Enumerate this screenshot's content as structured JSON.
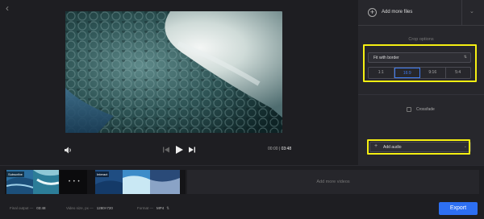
{
  "side": {
    "add_files_label": "Add more files",
    "crop_title": "Crop options",
    "fit_value": "Fit with border",
    "ratios": [
      "1:1",
      "16:9",
      "9:16",
      "5:4"
    ],
    "crossfade_label": "Crossfade",
    "add_audio_label": "Add audio"
  },
  "player": {
    "current_time": "00:00",
    "separator": "|",
    "duration": "03:48"
  },
  "timeline": {
    "clip1_label": "Subscribe",
    "clip2_label": "Interact",
    "dots": "• • •",
    "add_more_label": "Add more videos"
  },
  "footer": {
    "final_output_label": "Final output —",
    "final_output_value": "03:48",
    "video_size_label": "Video size, px —",
    "video_size_value": "1280×720",
    "format_label": "Format —",
    "format_value": "MP4",
    "export_label": "Export"
  },
  "colors": {
    "accent": "#2d6ff2",
    "highlight": "#f5ef12",
    "background": "#1e1e22"
  },
  "icons": [
    "back-icon",
    "volume-icon",
    "prev-icon",
    "play-icon",
    "next-icon",
    "plus-circle-icon",
    "chevron-down-icon",
    "plus-icon",
    "format-caret-icon"
  ]
}
